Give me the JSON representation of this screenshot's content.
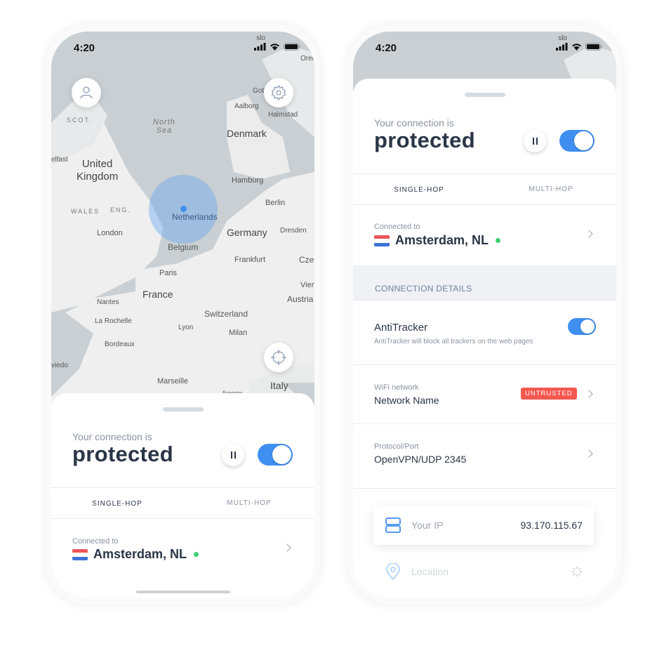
{
  "status_bar": {
    "time": "4:20",
    "carrier_hint": "slo"
  },
  "map": {
    "labels": {
      "north_sea": "North\nSea",
      "scot": "SCOT.",
      "belfast": "elfast",
      "uk": "United\nKingdom",
      "wales": "WALES",
      "eng": "ENG.",
      "london": "London",
      "netherlands": "Netherlands",
      "belgium": "Belgium",
      "denmark": "Denmark",
      "aalborg": "Aalborg",
      "halmstad": "Halmstad",
      "got": "Got",
      "orel": "Orel",
      "hamburg": "Hamburg",
      "berlin": "Berlin",
      "germany": "Germany",
      "dresden": "Dresden",
      "frankfurt": "Frankfurt",
      "czech": "Czec",
      "paris": "Paris",
      "france": "France",
      "nantes": "Nantes",
      "la_rochelle": "La Rochelle",
      "bordeaux": "Bordeaux",
      "lyon": "Lyon",
      "switzerland": "Switzerland",
      "milan": "Milan",
      "vienna": "Vien",
      "austria": "Austria",
      "marseille": "Marseille",
      "italy": "Italy",
      "oviedo": "viedo",
      "ajaccio": "Ajaccio"
    },
    "accent": "#3f8ff0"
  },
  "connection": {
    "label": "Your connection is",
    "state": "protected",
    "paused": false,
    "enabled": true
  },
  "tabs": [
    {
      "label": "SINGLE-HOP",
      "active": true
    },
    {
      "label": "MULTI-HOP",
      "active": false
    }
  ],
  "server": {
    "label": "Connected to",
    "city": "Amsterdam, NL",
    "status_color": "#3bd16f"
  },
  "details": {
    "section_title": "CONNECTION DETAILS",
    "antitracker": {
      "title": "AntiTracker",
      "subtitle": "AntiTracker will block all trackers on the web pages",
      "enabled": true
    },
    "wifi": {
      "label": "WiFi network",
      "value": "Network Name",
      "badge": "UNTRUSTED",
      "badge_color": "#f4574f"
    },
    "protocol": {
      "label": "Protocol/Port",
      "value": "OpenVPN/UDP 2345"
    },
    "ip": {
      "label": "Your IP",
      "value": "93.170.115.67"
    },
    "location": {
      "label": "Location"
    }
  }
}
